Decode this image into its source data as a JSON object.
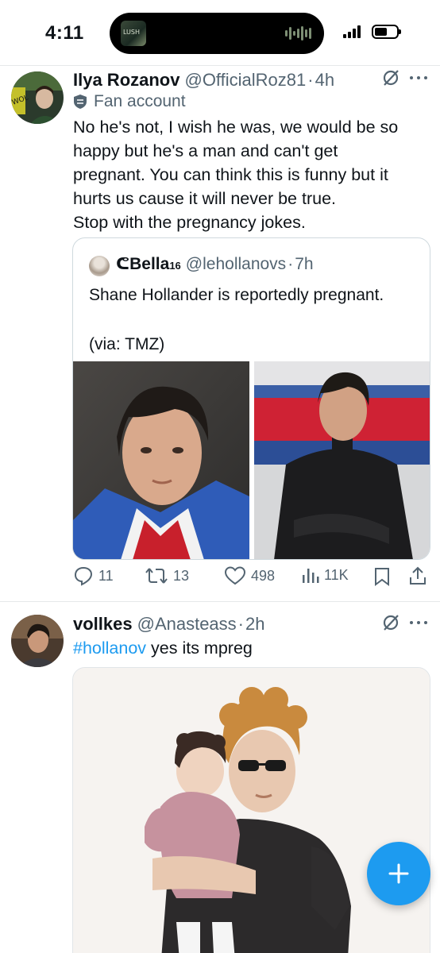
{
  "status_bar": {
    "time": "4:11",
    "now_playing_label": "LUSH"
  },
  "tweets": [
    {
      "name": "Ilya Rozanov",
      "handle": "@OfficialRoz81",
      "dot": "·",
      "time": "4h",
      "account_label": "Fan account",
      "text_lines": [
        "No he's not, I wish he was, we would be so",
        "happy but he's a man and can't get",
        "pregnant. You can think this is funny but it",
        "hurts us cause it will never be true.",
        "Stop with the pregnancy jokes."
      ],
      "quote": {
        "name": "Bella",
        "name_sup": "16",
        "name_prefix_glyph": "ᕦ",
        "handle": "@lehollanovs",
        "dot": "·",
        "time": "7h",
        "text": "Shane Hollander is reportedly pregnant.\n\n(via: TMZ)"
      },
      "actions": {
        "replies": "11",
        "retweets": "13",
        "likes": "498",
        "views": "11K"
      }
    },
    {
      "name": "vollkes",
      "handle": "@Anasteass",
      "dot": "·",
      "time": "2h",
      "hashtag": "#hollanov",
      "text_rest": " yes its mpreg"
    }
  ],
  "colors": {
    "accent": "#1d9bf0",
    "secondary_text": "#536471",
    "primary_text": "#0f1419",
    "border": "#cfd9de"
  },
  "icons": [
    "grok-icon",
    "more-icon",
    "fan-account-shield-icon",
    "reply-icon",
    "retweet-icon",
    "like-icon",
    "views-icon",
    "bookmark-icon",
    "share-icon",
    "compose-plus-icon"
  ]
}
